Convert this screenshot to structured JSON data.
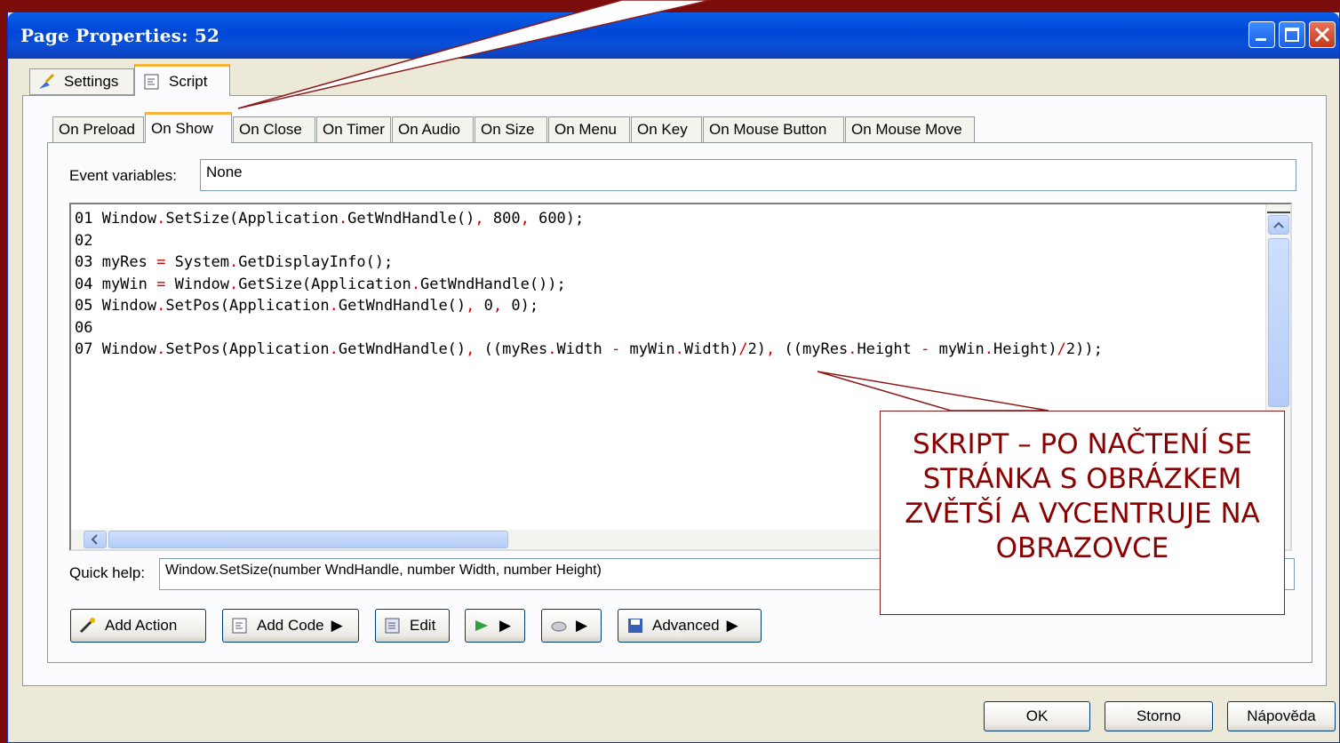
{
  "window": {
    "title": "Page Properties: 52"
  },
  "main_tabs": [
    {
      "label": "Settings",
      "icon": "broom-icon"
    },
    {
      "label": "Script",
      "icon": "script-icon"
    }
  ],
  "event_tabs": [
    "On Preload",
    "On Show",
    "On Close",
    "On Timer",
    "On Audio",
    "On Size",
    "On Menu",
    "On Key",
    "On Mouse Button",
    "On Mouse Move"
  ],
  "active_event_tab": "On Show",
  "event_variables": {
    "label": "Event variables:",
    "value": "None"
  },
  "code_lines": [
    "01 Window.SetSize(Application.GetWndHandle(), 800, 600);",
    "02",
    "03 myRes = System.GetDisplayInfo();",
    "04 myWin = Window.GetSize(Application.GetWndHandle());",
    "05 Window.SetPos(Application.GetWndHandle(), 0, 0);",
    "06",
    "07 Window.SetPos(Application.GetWndHandle(), ((myRes.Width - myWin.Width)/2), ((myRes.Height - myWin.Height)/2));"
  ],
  "quick_help": {
    "label": "Quick help:",
    "value": "Window.SetSize(number WndHandle, number Width, number Height)"
  },
  "action_buttons": {
    "add_action": "Add Action",
    "add_code": "Add Code",
    "edit": "Edit",
    "advanced": "Advanced"
  },
  "dialog_buttons": {
    "ok": "OK",
    "cancel": "Storno",
    "help": "Nápověda"
  },
  "callout": {
    "text": "SKRIPT – PO NAČTENÍ SE STRÁNKA S OBRÁZKEM ZVĚTŠÍ A VYCENTRUJE NA OBRAZOVCE"
  },
  "colors": {
    "callout_text": "#8b0000",
    "slide_background": "#7a0c0c",
    "titlebar": "#0047d8"
  }
}
